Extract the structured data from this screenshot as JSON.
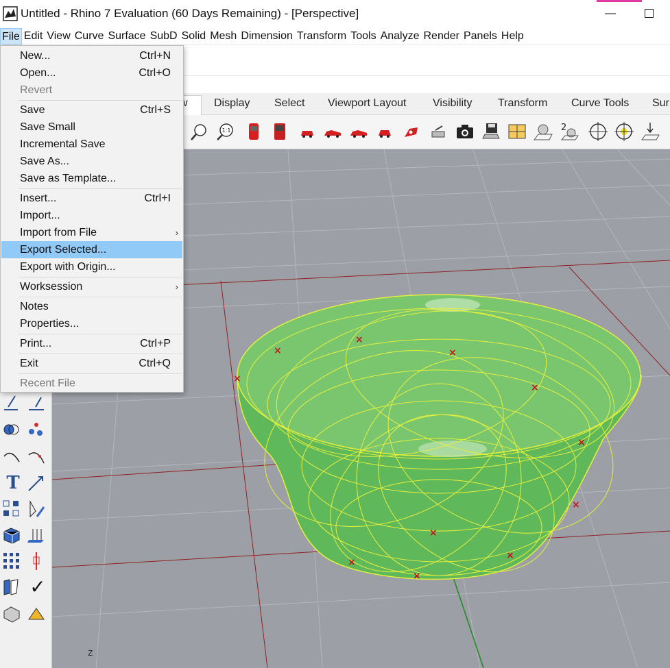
{
  "window": {
    "title": "Untitled - Rhino 7 Evaluation (60 Days Remaining) - [Perspective]",
    "minimize_glyph": "—",
    "accent_color": "#e13aa2"
  },
  "menubar": {
    "items": [
      "File",
      "Edit",
      "View",
      "Curve",
      "Surface",
      "SubD",
      "Solid",
      "Mesh",
      "Dimension",
      "Transform",
      "Tools",
      "Analyze",
      "Render",
      "Panels",
      "Help"
    ],
    "active": "File"
  },
  "toolbar_tabs": {
    "items": [
      "w",
      "Display",
      "Select",
      "Viewport Layout",
      "Visibility",
      "Transform",
      "Curve Tools",
      "Sur"
    ]
  },
  "file_menu": {
    "new": {
      "label": "New...",
      "shortcut": "Ctrl+N"
    },
    "open": {
      "label": "Open...",
      "shortcut": "Ctrl+O"
    },
    "revert": {
      "label": "Revert"
    },
    "save": {
      "label": "Save",
      "shortcut": "Ctrl+S"
    },
    "save_small": {
      "label": "Save Small"
    },
    "incremental_save": {
      "label": "Incremental Save"
    },
    "save_as": {
      "label": "Save As..."
    },
    "save_as_template": {
      "label": "Save as Template..."
    },
    "insert": {
      "label": "Insert...",
      "shortcut": "Ctrl+I"
    },
    "import": {
      "label": "Import..."
    },
    "import_from_file": {
      "label": "Import from File",
      "arrow": "›"
    },
    "export_selected": {
      "label": "Export Selected..."
    },
    "export_with_origin": {
      "label": "Export with Origin..."
    },
    "worksession": {
      "label": "Worksession",
      "arrow": "›"
    },
    "notes": {
      "label": "Notes"
    },
    "properties": {
      "label": "Properties..."
    },
    "print": {
      "label": "Print...",
      "shortcut": "Ctrl+P"
    },
    "exit": {
      "label": "Exit",
      "shortcut": "Ctrl+Q"
    },
    "recent_file": {
      "label": "Recent File"
    }
  },
  "viewport": {
    "name": "Perspective",
    "axis_label": "z",
    "background_color": "#9c9fa5",
    "object_color": "#5fb85a",
    "wire_color": "#e6f03c"
  },
  "left_panel": {
    "text_tool_glyph": "T",
    "check_glyph": "✓"
  },
  "toolbar_icons": {
    "zoom_1to1_label": "1:1",
    "two_glyph": "2"
  }
}
